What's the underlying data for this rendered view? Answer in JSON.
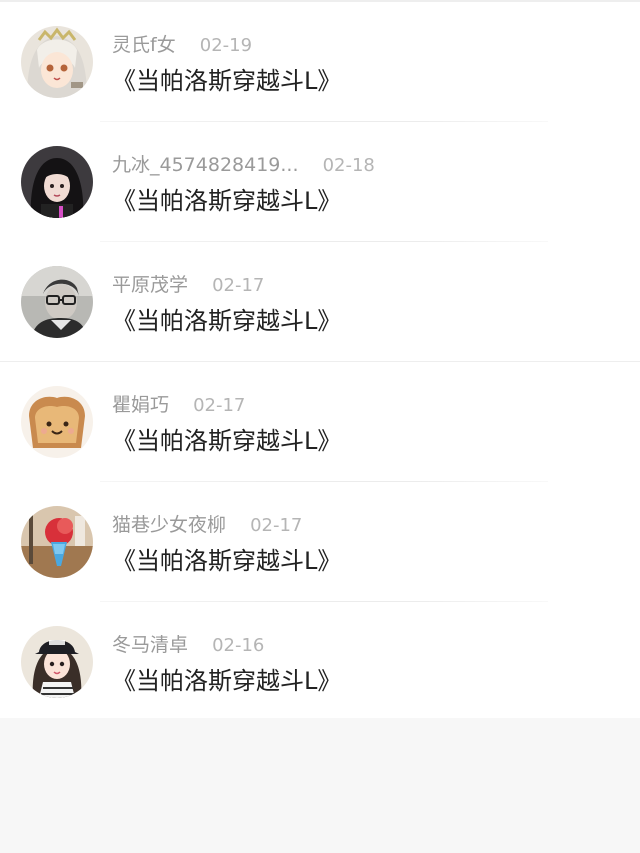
{
  "comments": [
    {
      "user": "灵氏f女",
      "date": "02-19",
      "text": "《当帕洛斯穿越斗L》",
      "avatar": "anime-girl-avatar"
    },
    {
      "user": "九冰_4574828419...",
      "date": "02-18",
      "text": "《当帕洛斯穿越斗L》",
      "avatar": "dark-hair-girl-avatar"
    },
    {
      "user": "平原茂学",
      "date": "02-17",
      "text": "《当帕洛斯穿越斗L》",
      "avatar": "glasses-person-avatar"
    },
    {
      "user": "瞿娟巧",
      "date": "02-17",
      "text": "《当帕洛斯穿越斗L》",
      "avatar": "toast-bread-avatar"
    },
    {
      "user": "猫巷少女夜柳",
      "date": "02-17",
      "text": "《当帕洛斯穿越斗L》",
      "avatar": "ice-cream-avatar"
    },
    {
      "user": "冬马清卓",
      "date": "02-16",
      "text": "《当帕洛斯穿越斗L》",
      "avatar": "cap-girl-avatar"
    }
  ]
}
